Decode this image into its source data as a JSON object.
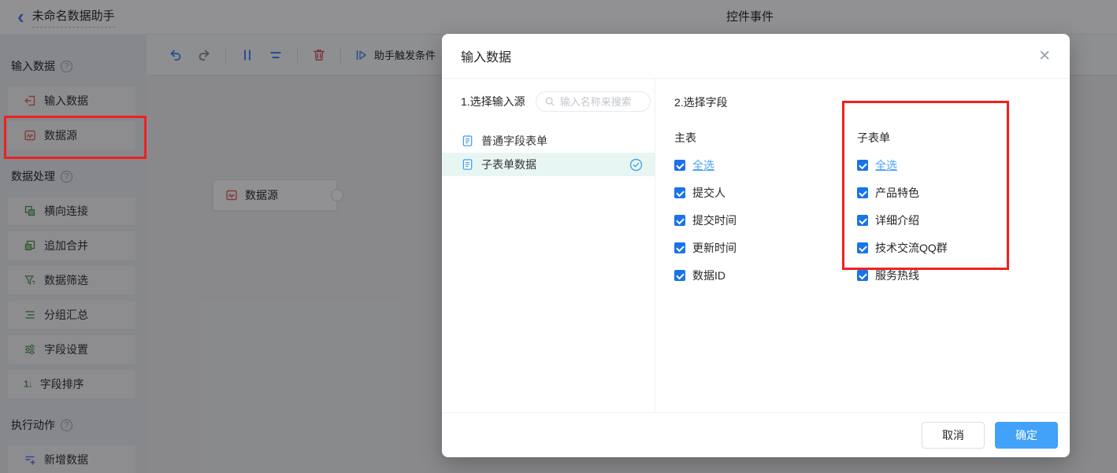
{
  "glyphs": {
    "back": "‹",
    "help": "?",
    "close": "✕",
    "sort_icon": "1↓"
  },
  "colors": {
    "accent_blue": "#1a73e8",
    "link_blue": "#4da3f5",
    "confirm_blue": "#42a1f8",
    "annotation_red": "#f12020",
    "icon_green": "#5aa05a",
    "icon_coral": "#e0675f",
    "icon_violet": "#5f7af2",
    "trash_red": "#e25050",
    "selected_row_bg": "#e8f6f3"
  },
  "topbar": {
    "title": "未命名数据助手",
    "center_title": "控件事件"
  },
  "sidebar": {
    "sections": [
      {
        "title": "输入数据",
        "items": [
          {
            "label": "输入数据",
            "icon": "input-icon"
          },
          {
            "label": "数据源",
            "icon": "datasource-icon"
          }
        ]
      },
      {
        "title": "数据处理",
        "items": [
          {
            "label": "横向连接",
            "icon": "horizontal-join-icon"
          },
          {
            "label": "追加合并",
            "icon": "append-merge-icon"
          },
          {
            "label": "数据筛选",
            "icon": "data-filter-icon"
          },
          {
            "label": "分组汇总",
            "icon": "group-summary-icon"
          },
          {
            "label": "字段设置",
            "icon": "field-settings-icon"
          },
          {
            "label": "字段排序",
            "icon": "field-sort-icon"
          }
        ]
      },
      {
        "title": "执行动作",
        "items": [
          {
            "label": "新增数据",
            "icon": "add-data-icon"
          }
        ]
      }
    ]
  },
  "toolbar": {
    "trigger_label": "助手触发条件"
  },
  "canvas": {
    "node_label": "数据源"
  },
  "modal": {
    "title": "输入数据",
    "source_section": {
      "label": "1.选择输入源",
      "search_placeholder": "输入名称来搜索",
      "items": [
        {
          "label": "普通字段表单",
          "selected": false
        },
        {
          "label": "子表单数据",
          "selected": true
        }
      ]
    },
    "fields_section": {
      "label": "2.选择字段",
      "columns": [
        {
          "title": "主表",
          "select_all": "全选",
          "fields": [
            "提交人",
            "提交时间",
            "更新时间",
            "数据ID"
          ]
        },
        {
          "title": "子表单",
          "select_all": "全选",
          "fields": [
            "产品特色",
            "详细介绍",
            "技术交流QQ群",
            "服务热线"
          ]
        }
      ]
    },
    "footer": {
      "cancel_label": "取消",
      "confirm_label": "确定"
    }
  }
}
